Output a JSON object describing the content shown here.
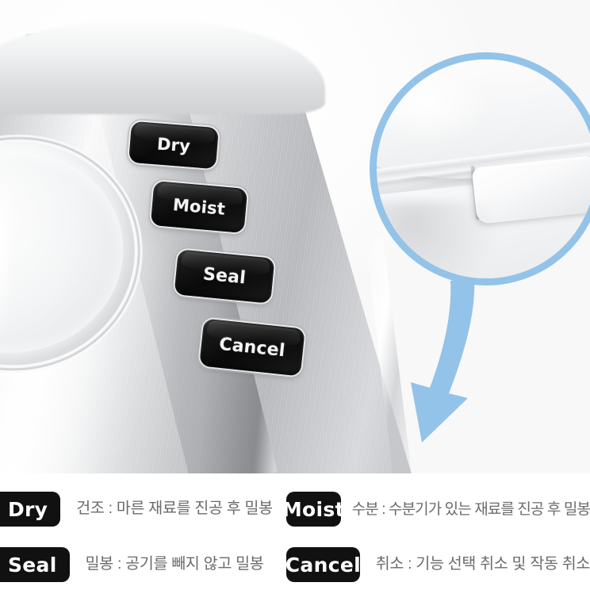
{
  "product": {
    "alt_name": "stainless-steel-vacuum-sealer-control-panel",
    "panel_buttons": [
      {
        "id": "dry",
        "label": "Dry"
      },
      {
        "id": "moist",
        "label": "Moist"
      },
      {
        "id": "seal",
        "label": "Seal"
      },
      {
        "id": "cancel",
        "label": "Cancel"
      }
    ],
    "callout": {
      "name": "lid-latch-detail",
      "ring_color": "#93c3e8",
      "arrow_color": "#93c3e8"
    }
  },
  "legend": {
    "rows": [
      {
        "left": {
          "badge": "Dry",
          "desc": "건조 : 마른 재료를 진공 후 밀봉"
        },
        "right": {
          "badge": "Moist",
          "desc": "수분 : 수분기가 있는 재료를 진공 후 밀봉"
        }
      },
      {
        "left": {
          "badge": "Seal",
          "desc": "밀봉 : 공기를 빼지 않고 밀봉"
        },
        "right": {
          "badge": "Cancel",
          "desc": "취소 : 기능 선택 취소 및 작동 취소"
        }
      }
    ],
    "badge_bg": "#111111",
    "badge_fg": "#ffffff",
    "desc_color": "#6b6b6b"
  }
}
